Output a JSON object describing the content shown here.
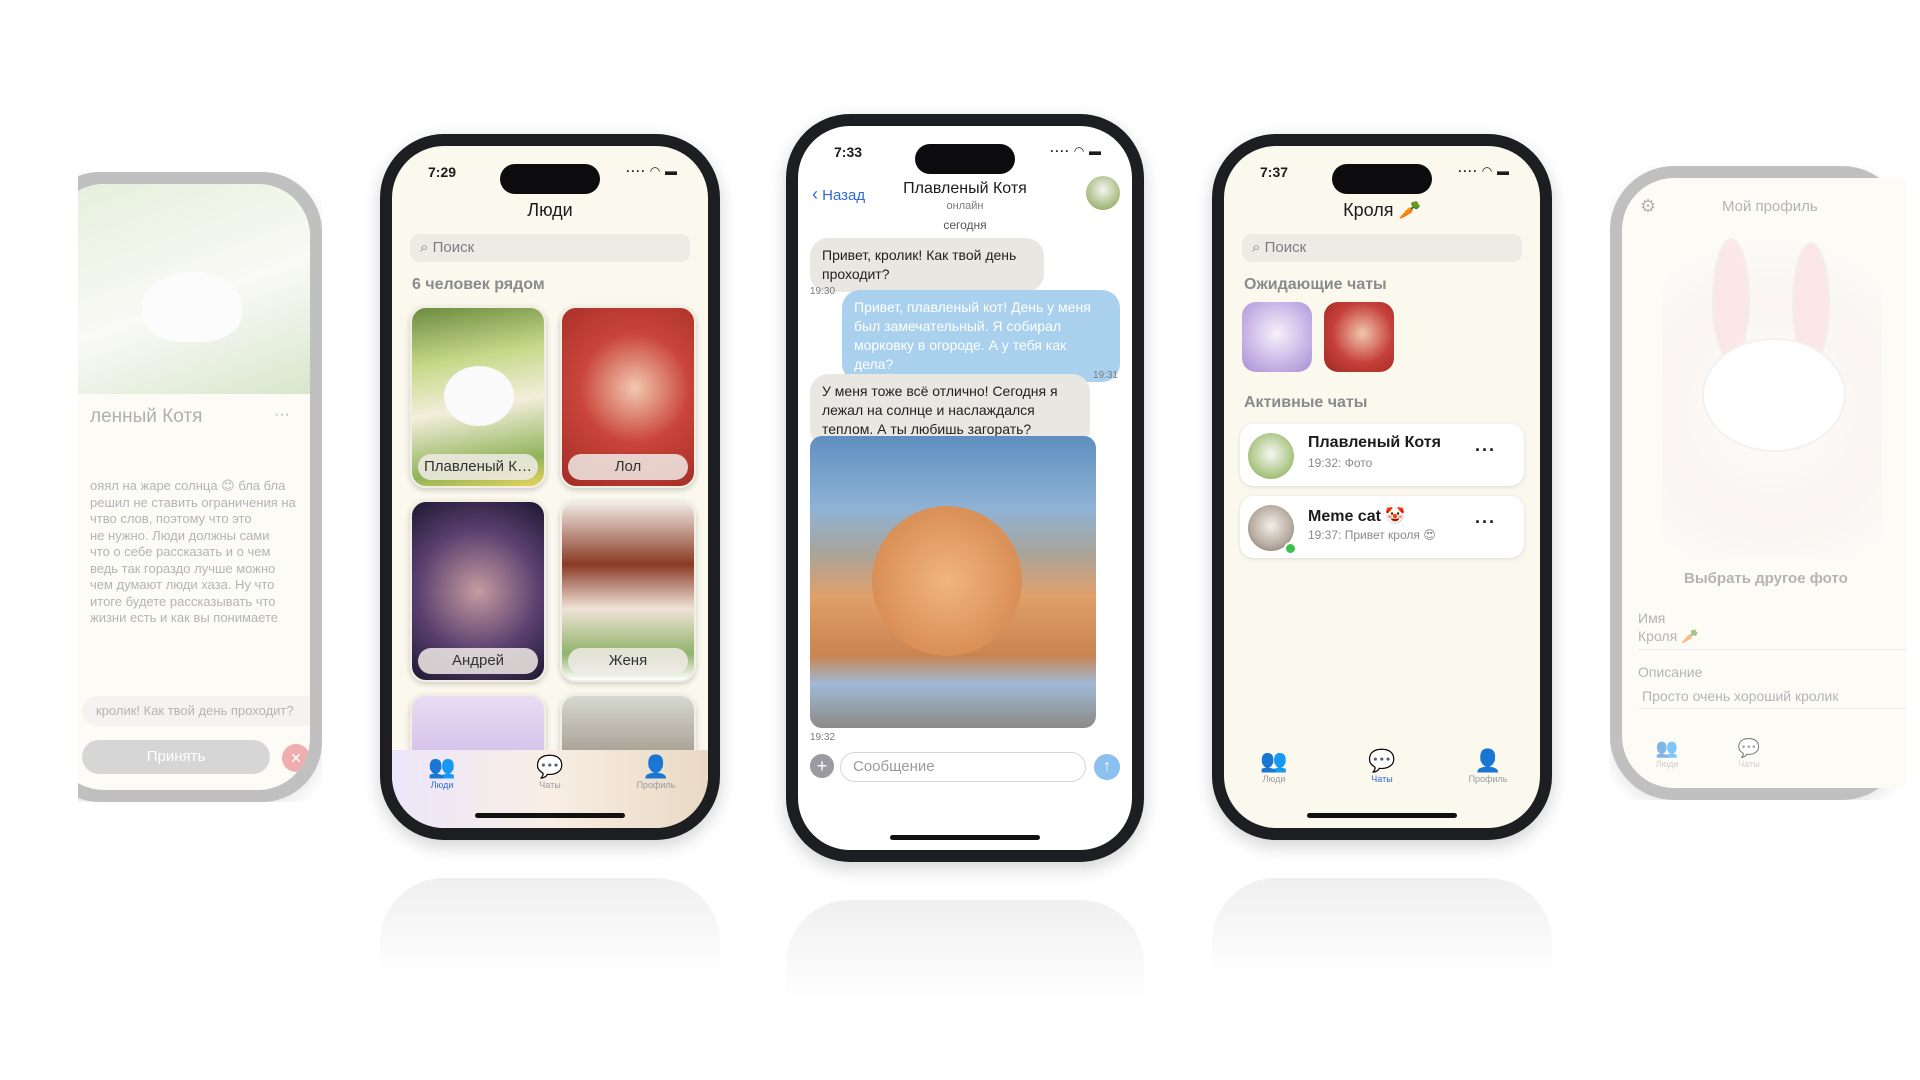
{
  "left_phone": {
    "name": "ленный Котя",
    "more": "···",
    "bio_lines": [
      "ояял на жаре солнца 😊 бла бла",
      "решил не ставить ограничения на",
      "чтво слов, поэтому что это",
      "не нужно. Люди должны сами",
      "что о себе рассказать и о чем",
      "ведь так гораздо лучше можно",
      "чем думают люди хаза. Ну что",
      "итоге будете рассказывать что",
      "жизни есть и как вы понимаете"
    ],
    "message_preview": "кролик! Как твой день проходит?",
    "accept_label": "Принять",
    "decline_icon": "✕"
  },
  "phone_people": {
    "time": "7:29",
    "status_icons": "····  ◠ ▬",
    "title": "Люди",
    "search_placeholder": "Поиск",
    "nearby_label": "6 человек рядом",
    "cards": [
      "Плавленый Кот...",
      "Лол",
      "Андрей",
      "Женя"
    ],
    "tabs": [
      {
        "label": "Люди",
        "icon": "people-icon",
        "active": true
      },
      {
        "label": "Чаты",
        "icon": "chat-icon",
        "active": false
      },
      {
        "label": "Профиль",
        "icon": "person-icon",
        "active": false
      }
    ]
  },
  "phone_chat": {
    "time": "7:33",
    "status_icons": "····  ◠ ▬",
    "back_label": "Назад",
    "contact_name": "Плавленый Котя",
    "contact_status": "онлайн",
    "date_label": "сегодня",
    "messages": [
      {
        "text": "Привет, кролик! Как твой день проходит?",
        "time": "19:30"
      },
      {
        "text": "Привет, плавленый кот! День у меня был замечательный. Я собирал морковку в огороде. А у тебя как дела?",
        "time": "19:31"
      },
      {
        "text": "У меня тоже всё отлично! Сегодня я лежал на солнце и наслаждался теплом. А ты любишь загорать?",
        "time": ""
      },
      {
        "text": "",
        "time": "19:32"
      }
    ],
    "input_placeholder": "Сообщение"
  },
  "phone_chats": {
    "time": "7:37",
    "status_icons": "····  ◠ ▬",
    "title": "Кроля 🥕",
    "search_placeholder": "Поиск",
    "waiting_label": "Ожидающие чаты",
    "active_label": "Активные чаты",
    "chats": [
      {
        "name": "Плавленый Котя",
        "sub": "19:32: Фото",
        "more": "···"
      },
      {
        "name": "Meme cat 🤡",
        "sub": "19:37: Привет кроля 😍",
        "more": "···"
      }
    ],
    "tabs": [
      {
        "label": "Люди",
        "icon": "people-icon",
        "active": false
      },
      {
        "label": "Чаты",
        "icon": "chat-icon",
        "active": true
      },
      {
        "label": "Профиль",
        "icon": "person-icon",
        "active": false
      }
    ]
  },
  "right_phone": {
    "title": "Мой профиль",
    "choose_photo": "Выбрать другое фото",
    "name_label": "Имя",
    "name_value": "Кроля 🥕",
    "desc_label": "Описание",
    "desc_value": "Просто очень хороший кролик",
    "tabs": [
      "Люди",
      "Чаты"
    ]
  }
}
